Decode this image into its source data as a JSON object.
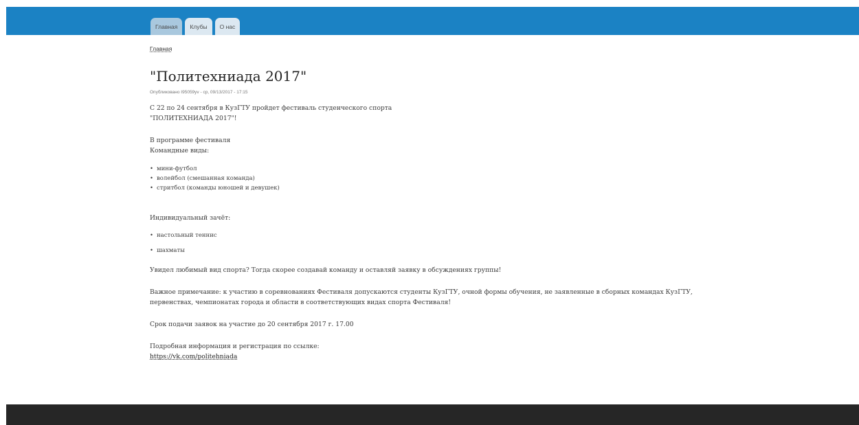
{
  "header": {
    "tabs": [
      {
        "label": "Главная",
        "active": true
      },
      {
        "label": "Клубы",
        "active": false
      },
      {
        "label": "О нас",
        "active": false
      }
    ]
  },
  "breadcrumb": {
    "home": "Главная"
  },
  "article": {
    "title": "\"Политехниада 2017\"",
    "meta": "Опубликовано I95059yv - ср, 09/13/2017 - 17:15",
    "intro_line1": "С 22 по 24 сентября в КузГТУ пройдет фестиваль студенческого спорта",
    "intro_line2": "\"ПОЛИТЕХНИАДА 2017\"!",
    "program_heading": "В программе фестиваля",
    "team_heading": "Командные виды:",
    "team_sports": [
      "мини-футбол",
      "волейбол (смешанная команда)",
      "стритбол (команды юношей и девушек)"
    ],
    "individual_heading": "Индивидуальный зачёт:",
    "individual_sports": [
      "настольный теннис",
      "шахматы"
    ],
    "call_to_action": "Увидел любимый вид спорта? Тогда скорее создавай команду и оставляй заявку в обсуждениях группы!",
    "note_line1": "Важное примечание: к участию в соревнованиях Фестиваля допускаются студенты КузГТУ, очной формы обучения, не заявленные в сборных командах КузГТУ,",
    "note_line2": "первенствах, чемпионатах города и области в соответствующих видах спорта Фестиваля!",
    "deadline": "Срок подачи заявок на участие до 20 сентября 2017 г. 17.00",
    "info_label": "Подробная информация и регистрация по ссылке:",
    "info_link": "https://vk.com/politehniada"
  },
  "colors": {
    "header": "#1b82c4",
    "footer": "#262626",
    "tab": "#dce8f1",
    "tab_active": "#a9c8de"
  }
}
